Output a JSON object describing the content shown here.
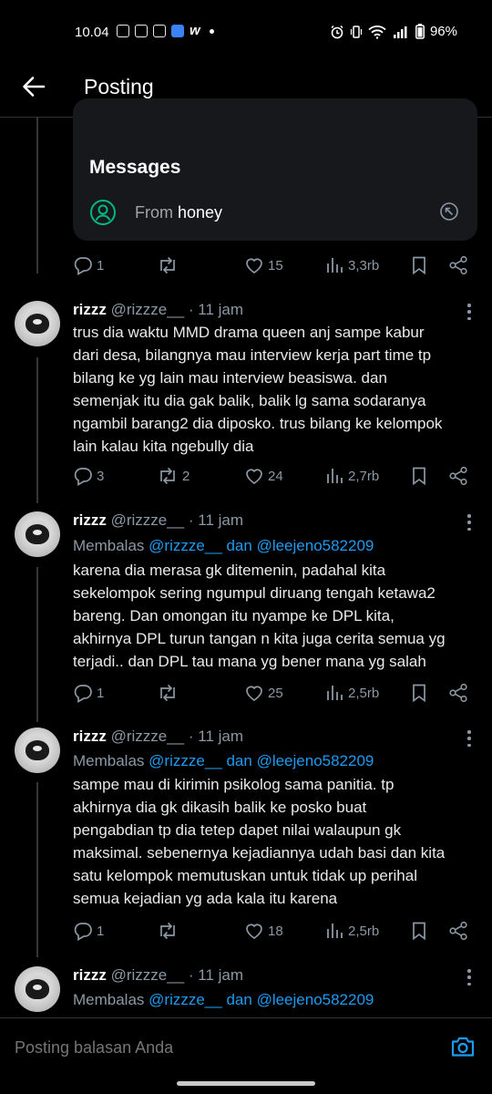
{
  "status_bar": {
    "time": "10.04",
    "battery": "96%"
  },
  "header": {
    "title": "Posting"
  },
  "card": {
    "title": "Messages",
    "from_label": "From",
    "from_name": "honey"
  },
  "card_actions": {
    "replies": "1",
    "reposts": "",
    "likes": "15",
    "views": "3,3rb"
  },
  "tweets": [
    {
      "name": "rizzz",
      "handle": "@rizzze__ · 11 jam",
      "reply_prefix": "",
      "mentions": [],
      "lines": [
        "trus dia waktu MMD drama queen anj sampe kabur",
        "dari desa, bilangnya mau interview kerja part time tp",
        "bilang ke yg lain mau interview beasiswa. dan",
        "semenjak itu dia gak balik, balik lg sama sodaranya",
        "ngambil barang2 dia diposko. trus bilang ke kelompok",
        "lain kalau kita ngebully dia"
      ],
      "replies": "3",
      "reposts": "2",
      "likes": "24",
      "views": "2,7rb"
    },
    {
      "name": "rizzz",
      "handle": "@rizzze__ · 11 jam",
      "reply_prefix": "Membalas",
      "mention1": "@rizzze__",
      "reply_and": "dan",
      "mention2": "@leejeno582209",
      "lines": [
        "karena dia merasa gk ditemenin, padahal kita",
        "sekelompok sering ngumpul diruang tengah ketawa2",
        "bareng. Dan omongan itu nyampe ke DPL kita,",
        "akhirnya DPL turun tangan n kita juga cerita semua yg",
        "terjadi.. dan DPL tau mana yg bener mana yg salah"
      ],
      "replies": "1",
      "reposts": "",
      "likes": "25",
      "views": "2,5rb"
    },
    {
      "name": "rizzz",
      "handle": "@rizzze__ · 11 jam",
      "reply_prefix": "Membalas",
      "mention1": "@rizzze__",
      "reply_and": "dan",
      "mention2": "@leejeno582209",
      "lines": [
        "sampe mau di kirimin psikolog sama panitia. tp",
        "akhirnya dia gk dikasih balik ke posko buat",
        "pengabdian tp dia tetep dapet nilai walaupun gk",
        "maksimal. sebenernya kejadiannya udah basi dan kita",
        "satu kelompok memutuskan untuk tidak up perihal",
        "semua kejadian yg ada kala itu karena"
      ],
      "replies": "1",
      "reposts": "",
      "likes": "18",
      "views": "2,5rb"
    },
    {
      "name": "rizzz",
      "handle": "@rizzze__ · 11 jam",
      "reply_prefix": "Membalas",
      "mention1": "@rizzze__",
      "reply_and": "dan",
      "mention2": "@leejeno582209"
    }
  ],
  "reply_bar": {
    "placeholder": "Posting balasan Anda"
  },
  "icons": {
    "back": "arrow-left-icon",
    "reply": "speech-bubble-icon",
    "repost": "repost-icon",
    "like": "heart-icon",
    "views": "bar-chart-icon",
    "bookmark": "bookmark-icon",
    "share": "share-icon",
    "camera": "camera-icon"
  },
  "colors": {
    "background": "#000000",
    "text": "#e7e9ea",
    "secondary": "#8b98a5",
    "link": "#1d9bf0",
    "card": "#16181c",
    "user_icon": "#00ba7c"
  }
}
